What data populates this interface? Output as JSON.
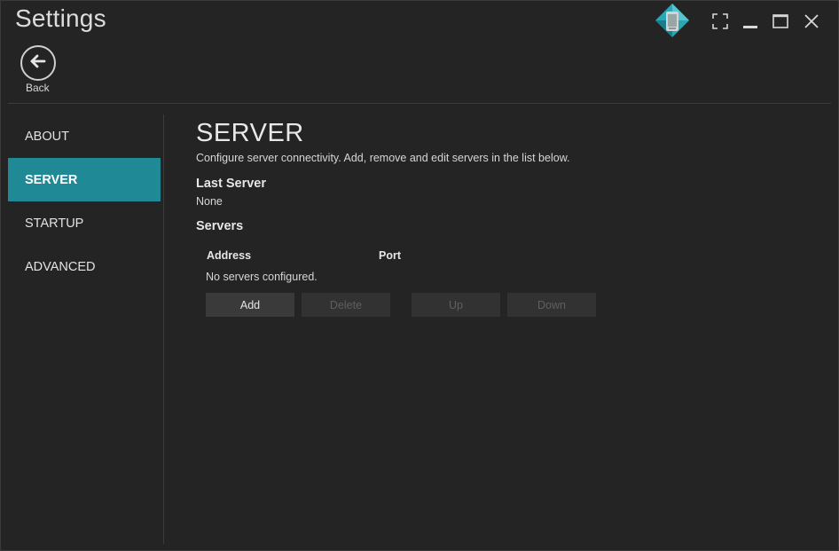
{
  "window": {
    "title": "Settings",
    "logo_icon": "app-logo-icon",
    "controls": [
      {
        "name": "fullscreen",
        "icon": "fullscreen-icon"
      },
      {
        "name": "minimize",
        "icon": "minimize-icon"
      },
      {
        "name": "maximize",
        "icon": "maximize-icon"
      },
      {
        "name": "close",
        "icon": "close-icon"
      }
    ]
  },
  "back": {
    "label": "Back",
    "icon": "arrow-left-icon"
  },
  "sidebar": {
    "items": [
      {
        "label": "ABOUT",
        "active": false
      },
      {
        "label": "SERVER",
        "active": true
      },
      {
        "label": "STARTUP",
        "active": false
      },
      {
        "label": "ADVANCED",
        "active": false
      }
    ]
  },
  "main": {
    "title": "SERVER",
    "description": "Configure server connectivity. Add, remove and edit servers in the list below.",
    "last_server": {
      "heading": "Last Server",
      "value": "None"
    },
    "servers": {
      "heading": "Servers",
      "columns": [
        "Address",
        "Port"
      ],
      "rows": [],
      "empty_message": "No servers configured.",
      "buttons": [
        {
          "label": "Add",
          "enabled": true
        },
        {
          "label": "Delete",
          "enabled": false
        },
        {
          "label": "Up",
          "enabled": false
        },
        {
          "label": "Down",
          "enabled": false
        }
      ]
    }
  },
  "colors": {
    "accent": "#1f8a96",
    "background": "#242424",
    "button": "#3a3a3a",
    "disabled_text": "#5f5f5f"
  }
}
